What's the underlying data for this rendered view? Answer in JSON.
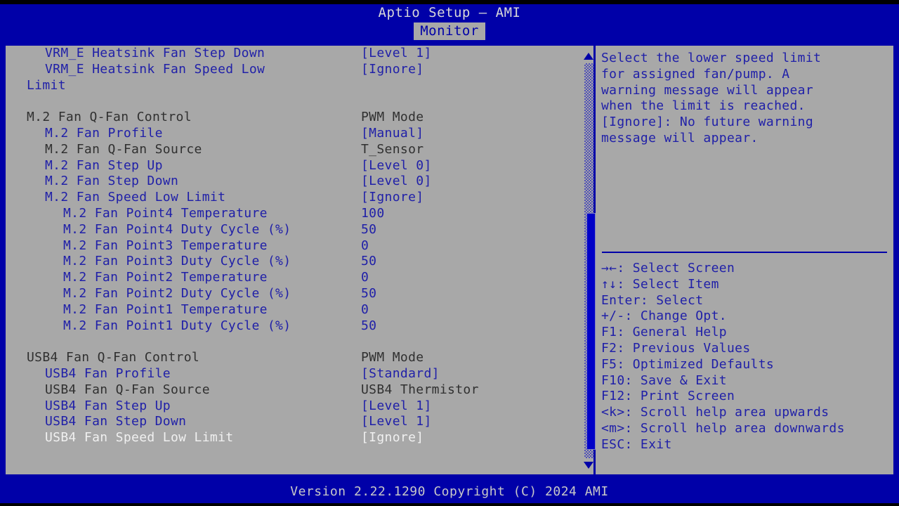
{
  "header": {
    "title": "Aptio Setup – AMI",
    "active_tab": "Monitor"
  },
  "options": [
    {
      "label": "VRM_E Heatsink Fan Step Down",
      "value": "[Level 1]",
      "indent": 1,
      "label_color": "blue",
      "value_color": "blue"
    },
    {
      "label": "VRM_E Heatsink Fan Speed Low",
      "value": "[Ignore]",
      "indent": 1,
      "label_color": "blue",
      "value_color": "blue"
    },
    {
      "label": "Limit",
      "value": "",
      "indent": 0,
      "label_color": "blue",
      "value_color": "blue"
    },
    {
      "label": "",
      "value": "",
      "indent": 0,
      "label_color": "blue",
      "value_color": "blue"
    },
    {
      "label": "M.2 Fan Q-Fan Control",
      "value": "PWM Mode",
      "indent": 0,
      "label_color": "dark",
      "value_color": "dark"
    },
    {
      "label": "M.2 Fan Profile",
      "value": "[Manual]",
      "indent": 1,
      "label_color": "blue",
      "value_color": "blue"
    },
    {
      "label": "M.2 Fan Q-Fan Source",
      "value": "T_Sensor",
      "indent": 1,
      "label_color": "dark",
      "value_color": "dark"
    },
    {
      "label": "M.2 Fan Step Up",
      "value": "[Level 0]",
      "indent": 1,
      "label_color": "blue",
      "value_color": "blue"
    },
    {
      "label": "M.2 Fan Step Down",
      "value": "[Level 0]",
      "indent": 1,
      "label_color": "blue",
      "value_color": "blue"
    },
    {
      "label": "M.2 Fan Speed Low Limit",
      "value": "[Ignore]",
      "indent": 1,
      "label_color": "blue",
      "value_color": "blue"
    },
    {
      "label": "M.2 Fan Point4 Temperature",
      "value": "100",
      "indent": 2,
      "label_color": "blue",
      "value_color": "blue"
    },
    {
      "label": "M.2 Fan Point4 Duty Cycle (%)",
      "value": "50",
      "indent": 2,
      "label_color": "blue",
      "value_color": "blue"
    },
    {
      "label": "M.2 Fan Point3 Temperature",
      "value": "0",
      "indent": 2,
      "label_color": "blue",
      "value_color": "blue"
    },
    {
      "label": "M.2 Fan Point3 Duty Cycle (%)",
      "value": "50",
      "indent": 2,
      "label_color": "blue",
      "value_color": "blue"
    },
    {
      "label": "M.2 Fan Point2 Temperature",
      "value": "0",
      "indent": 2,
      "label_color": "blue",
      "value_color": "blue"
    },
    {
      "label": "M.2 Fan Point2 Duty Cycle (%)",
      "value": "50",
      "indent": 2,
      "label_color": "blue",
      "value_color": "blue"
    },
    {
      "label": "M.2 Fan Point1 Temperature",
      "value": "0",
      "indent": 2,
      "label_color": "blue",
      "value_color": "blue"
    },
    {
      "label": "M.2 Fan Point1 Duty Cycle (%)",
      "value": "50",
      "indent": 2,
      "label_color": "blue",
      "value_color": "blue"
    },
    {
      "label": "",
      "value": "",
      "indent": 0,
      "label_color": "blue",
      "value_color": "blue"
    },
    {
      "label": "USB4 Fan Q-Fan Control",
      "value": "PWM Mode",
      "indent": 0,
      "label_color": "dark",
      "value_color": "dark"
    },
    {
      "label": "USB4 Fan Profile",
      "value": "[Standard]",
      "indent": 1,
      "label_color": "blue",
      "value_color": "blue"
    },
    {
      "label": "USB4 Fan Q-Fan Source",
      "value": "USB4 Thermistor",
      "indent": 1,
      "label_color": "dark",
      "value_color": "dark"
    },
    {
      "label": "USB4 Fan Step Up",
      "value": "[Level 1]",
      "indent": 1,
      "label_color": "blue",
      "value_color": "blue"
    },
    {
      "label": "USB4 Fan Step Down",
      "value": "[Level 1]",
      "indent": 1,
      "label_color": "blue",
      "value_color": "blue"
    },
    {
      "label": "USB4 Fan Speed Low Limit",
      "value": "[Ignore]",
      "indent": 1,
      "label_color": "white",
      "value_color": "white"
    }
  ],
  "help": {
    "lines": [
      "Select the lower speed limit",
      "for assigned fan/pump. A",
      "warning message will appear",
      "when the limit is reached.",
      "[Ignore]: No future warning",
      "message will appear."
    ]
  },
  "legend": {
    "lines": [
      "→←: Select Screen",
      "↑↓: Select Item",
      "Enter: Select",
      "+/-: Change Opt.",
      "F1: General Help",
      "F2: Previous Values",
      "F5: Optimized Defaults",
      "F10: Save & Exit",
      "F12: Print Screen",
      "<k>: Scroll help area upwards",
      "<m>: Scroll help area downwards",
      "ESC: Exit"
    ]
  },
  "scrollbar": {
    "up_arrow": "scroll-up-arrow",
    "down_arrow": "scroll-down-arrow"
  },
  "footer": {
    "version": "Version 2.22.1290 Copyright (C) 2024 AMI"
  },
  "colors": {
    "background_blue": "#0000a8",
    "panel_gray": "#a8a8a8",
    "text_blue": "#2020a8",
    "text_dark": "#303030",
    "text_selected": "#f0f0f0"
  }
}
